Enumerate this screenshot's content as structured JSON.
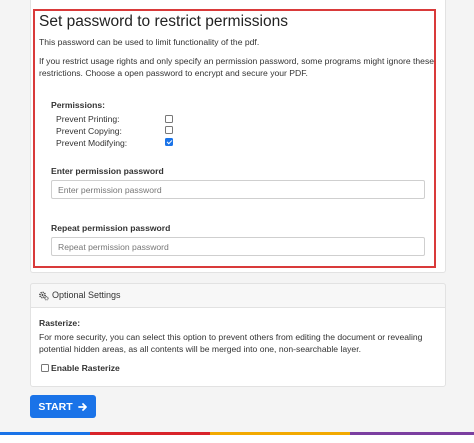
{
  "password_section": {
    "title": "Set password to restrict permissions",
    "intro": "This password can be used to limit functionality of the pdf.",
    "note_line1": "If you restrict usage rights and only specify an permission password, some programs might ignore these",
    "note_line2": "restrictions. Choose a open password to encrypt and secure your PDF.",
    "permissions_label": "Permissions:",
    "permissions": [
      {
        "label": "Prevent Printing:",
        "checked": false
      },
      {
        "label": "Prevent Copying:",
        "checked": false
      },
      {
        "label": "Prevent Modifying:",
        "checked": true
      }
    ],
    "enter_label": "Enter permission password",
    "enter_placeholder": "Enter permission password",
    "repeat_label": "Repeat permission password",
    "repeat_placeholder": "Repeat permission password",
    "highlight_color": "#d93a3a"
  },
  "optional_settings": {
    "header": "Optional Settings",
    "header_icon": "gears-icon",
    "rasterize_label": "Rasterize:",
    "rasterize_desc_line1": "For more security, you can select this option to prevent others from editing the document or revealing",
    "rasterize_desc_line2": "potential hidden areas, as all contents will be merged into one, non-searchable layer.",
    "enable_rasterize_label": "Enable Rasterize",
    "enable_rasterize_checked": false
  },
  "actions": {
    "start_label": "START",
    "start_icon": "arrow-right-icon",
    "accent_color": "#1a73e8"
  }
}
